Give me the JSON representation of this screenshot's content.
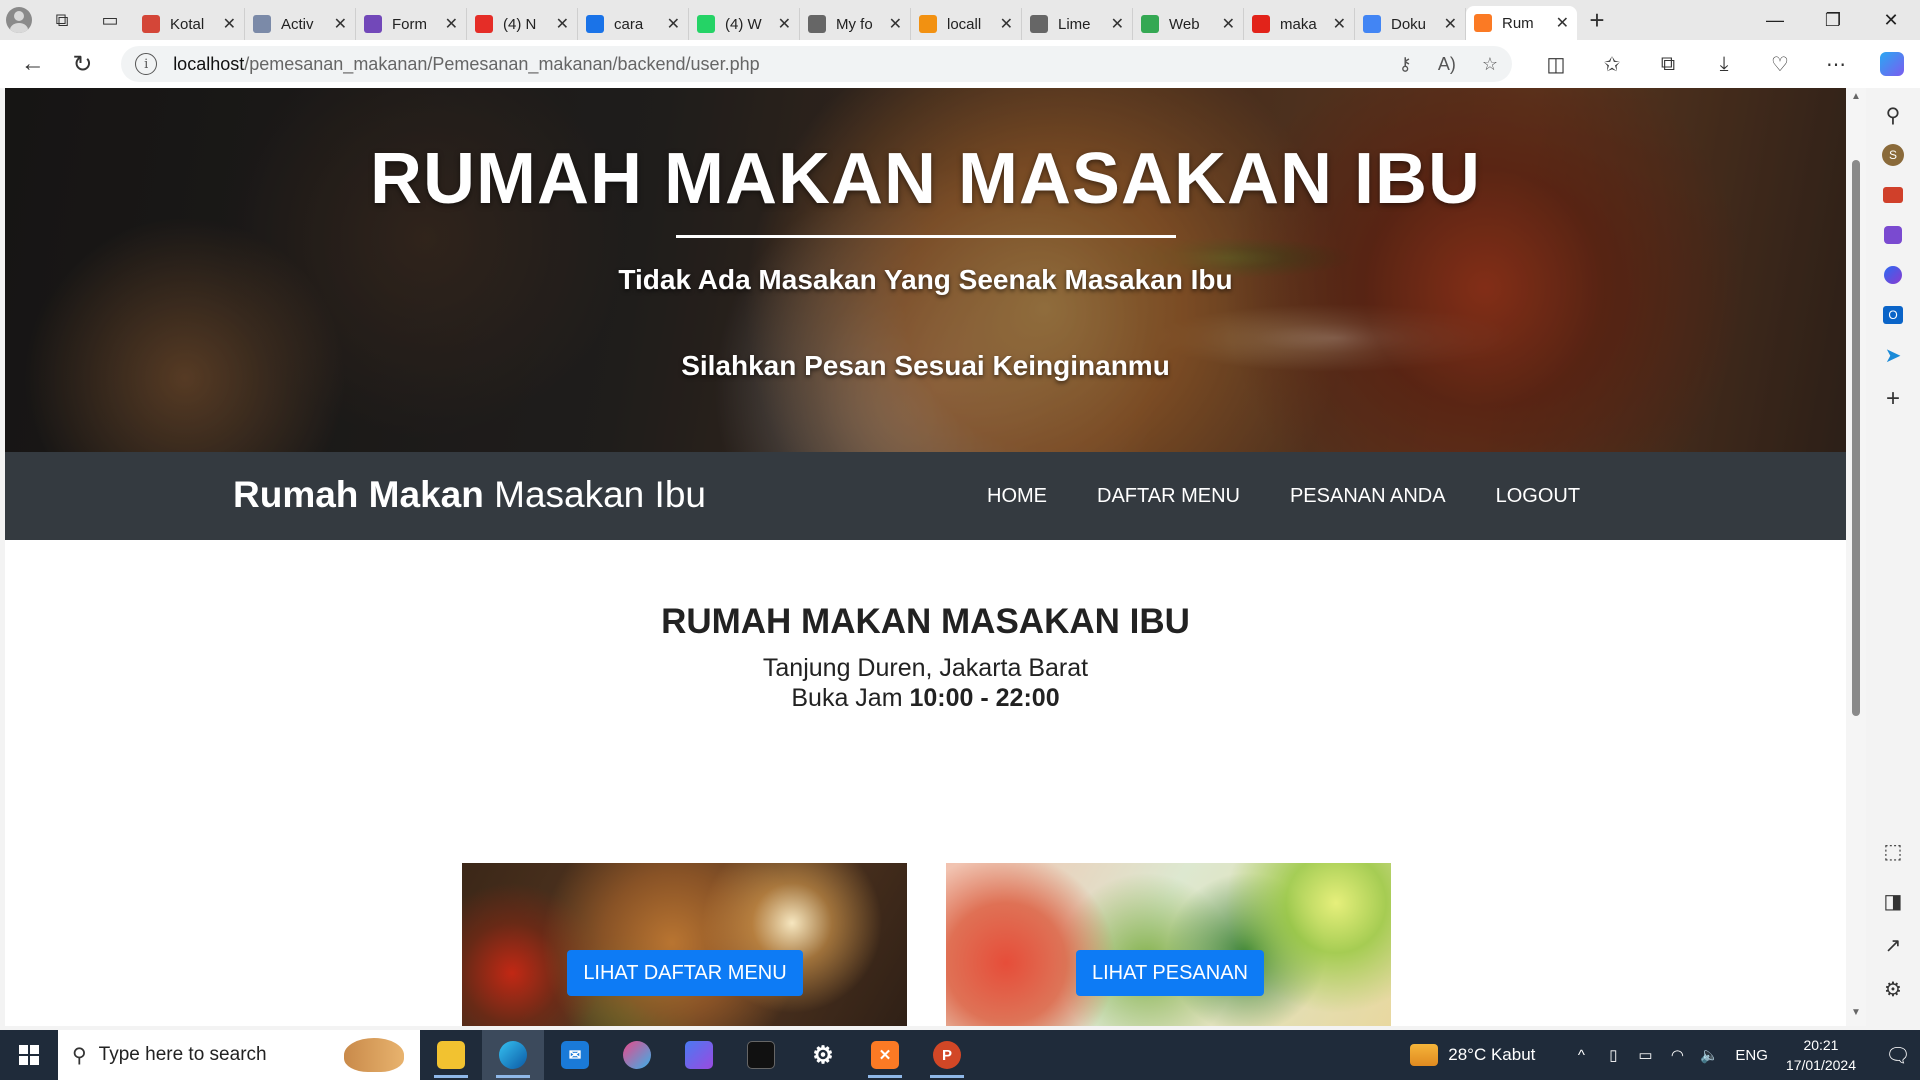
{
  "browser": {
    "tabs": [
      {
        "title": "Kotal",
        "icon": "gmail-icon",
        "color": "#d44638"
      },
      {
        "title": "Activ",
        "icon": "activity-icon",
        "color": "#7b8aa8"
      },
      {
        "title": "Form",
        "icon": "forms-icon",
        "color": "#7248b9"
      },
      {
        "title": "(4) N",
        "icon": "youtube-icon",
        "color": "#e52d27"
      },
      {
        "title": "cara",
        "icon": "search-icon",
        "color": "#1a73e8"
      },
      {
        "title": "(4) W",
        "icon": "whatsapp-icon",
        "color": "#25d366"
      },
      {
        "title": "My fo",
        "icon": "page-icon",
        "color": "#666666"
      },
      {
        "title": "locall",
        "icon": "phpmyadmin-icon",
        "color": "#f29111"
      },
      {
        "title": "Lime",
        "icon": "page-icon",
        "color": "#666666"
      },
      {
        "title": "Web",
        "icon": "drive-icon",
        "color": "#34a853"
      },
      {
        "title": "maka",
        "icon": "pdf-icon",
        "color": "#e2231a"
      },
      {
        "title": "Doku",
        "icon": "docs-icon",
        "color": "#4285f4"
      },
      {
        "title": "Rum",
        "icon": "xampp-icon",
        "color": "#fb7a24"
      }
    ],
    "url_host": "localhost",
    "url_path": "/pemesanan_makanan/Pemesanan_makanan/backend/user.php"
  },
  "hero": {
    "title": "RUMAH MAKAN MASAKAN IBU",
    "tagline": "Tidak Ada Masakan Yang Seenak Masakan Ibu",
    "subtitle": "Silahkan Pesan Sesuai Keinginanmu"
  },
  "navbar": {
    "brand_bold": "Rumah Makan",
    "brand_light": "Masakan Ibu",
    "links": [
      "HOME",
      "DAFTAR MENU",
      "PESANAN ANDA",
      "LOGOUT"
    ]
  },
  "info": {
    "title": "RUMAH MAKAN MASAKAN IBU",
    "address": "Tanjung Duren, Jakarta Barat",
    "hours_label": "Buka Jam",
    "hours_value": "10:00 - 22:00"
  },
  "cards": {
    "menu_button": "LIHAT DAFTAR MENU",
    "order_button": "LIHAT PESANAN"
  },
  "taskbar": {
    "search_placeholder": "Type here to search",
    "weather": "28°C  Kabut",
    "lang": "ENG",
    "time": "20:21",
    "date": "17/01/2024"
  }
}
